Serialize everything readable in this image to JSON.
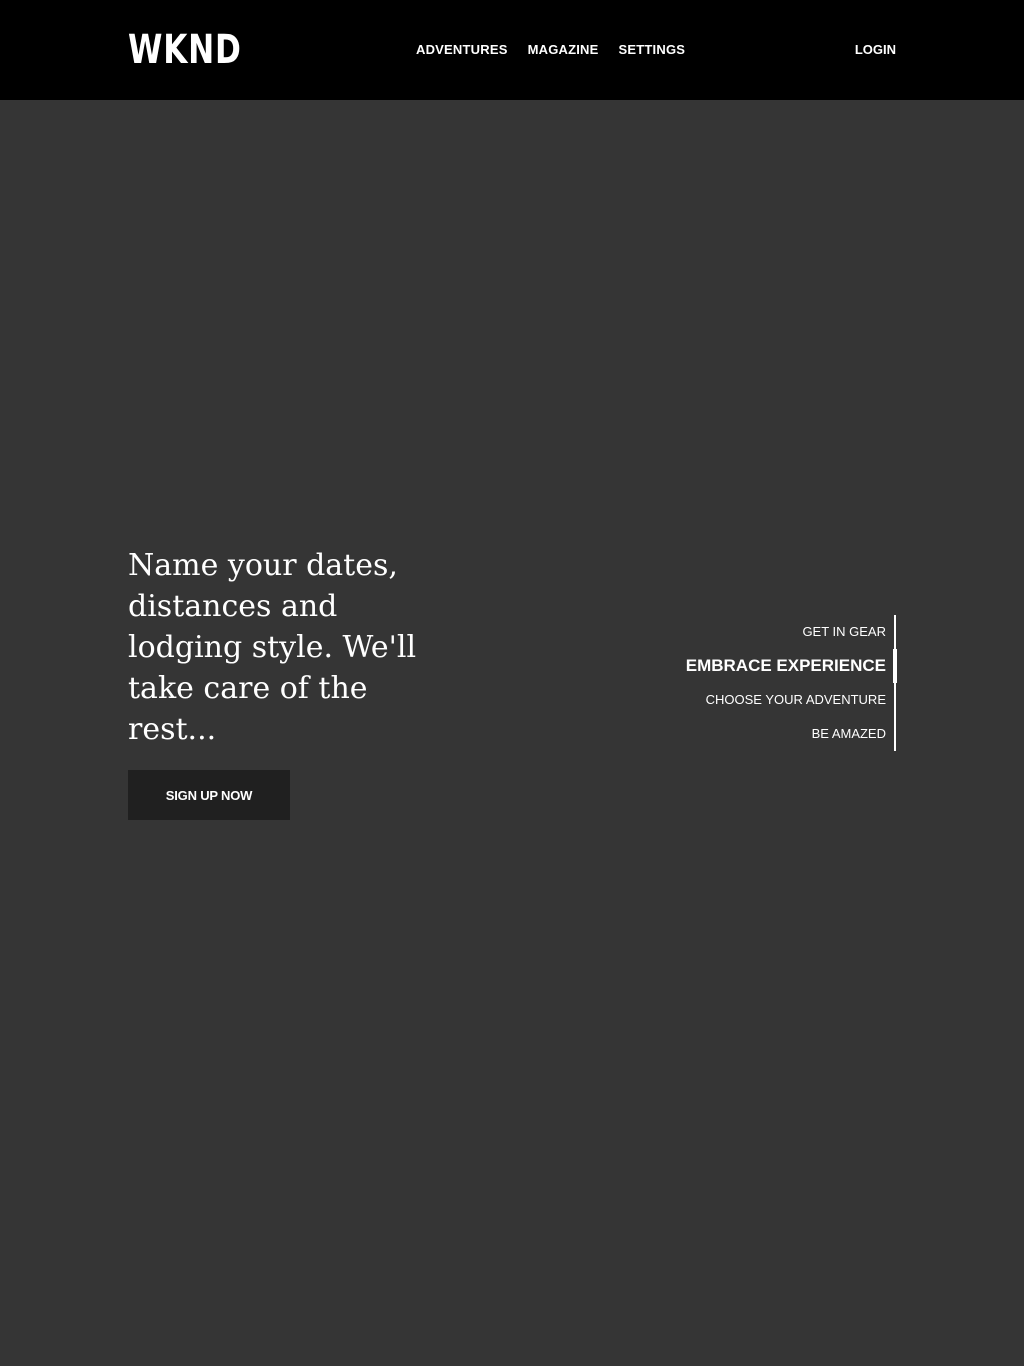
{
  "header": {
    "logo": "WKND",
    "nav": [
      "ADVENTURES",
      "MAGAZINE",
      "SETTINGS"
    ],
    "login_label": "LOGIN"
  },
  "hero": {
    "headline": "Name your dates, distances and lodging style. We'll take care of the rest...",
    "cta_label": "SIGN UP NOW"
  },
  "steps": {
    "items": [
      "GET IN GEAR",
      "EMBRACE EXPERIENCE",
      "CHOOSE YOUR ADVENTURE",
      "BE AMAZED"
    ],
    "active": "EMBRACE EXPERIENCE"
  },
  "colors": {
    "header_bg": "#000000",
    "hero_bg": "#353535",
    "button_bg": "#202020",
    "text": "#ffffff"
  }
}
